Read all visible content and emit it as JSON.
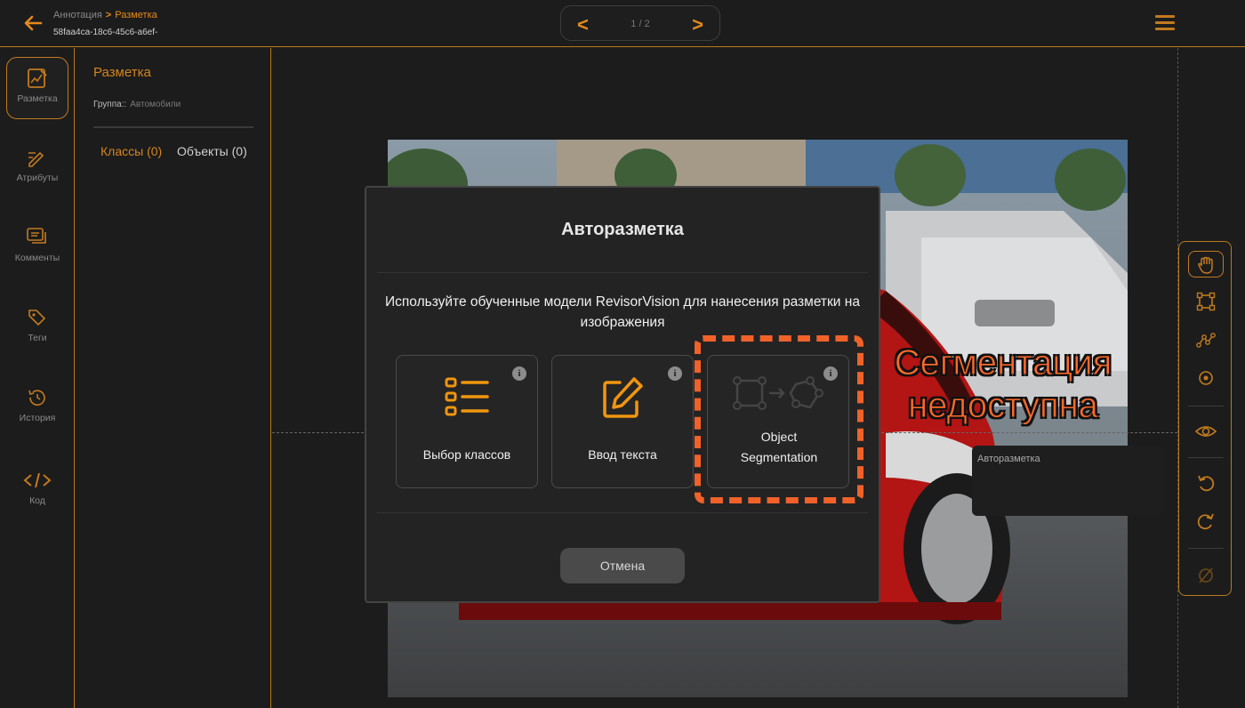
{
  "header": {
    "breadcrumb_parent": "Аннотация",
    "breadcrumb_sep": ">",
    "breadcrumb_current": "Разметка",
    "doc_id": "58faa4ca-18c6-45c6-a6ef-",
    "pager_prev": "<",
    "pager_next": ">",
    "pager_count": "1 / 2"
  },
  "nav": {
    "items": [
      {
        "label": "Разметка",
        "icon": "edit-chart-icon",
        "active": true
      },
      {
        "label": "Атрибуты",
        "icon": "pen-lines-icon"
      },
      {
        "label": "Комменты",
        "icon": "comments-icon"
      },
      {
        "label": "Теги",
        "icon": "tag-icon"
      },
      {
        "label": "История",
        "icon": "history-icon"
      },
      {
        "label": "Код",
        "icon": "code-icon"
      }
    ]
  },
  "panel": {
    "title": "Разметка",
    "group_label": "Группа::",
    "group_value": "Автомобили",
    "tab_classes": "Классы (0)",
    "tab_objects": "Объекты (0)"
  },
  "modal": {
    "title": "Авторазметка",
    "description": "Используйте обученные модели RevisorVision для нанесения разметки на изображения",
    "cards": [
      {
        "label": "Выбор классов",
        "icon": "list-icon",
        "info": "i"
      },
      {
        "label": "Ввод текста",
        "icon": "edit-icon",
        "info": "i"
      },
      {
        "label": "Object Segmentation",
        "icon": "segmentation-icon",
        "info": "i",
        "disabled": true
      }
    ],
    "cancel_label": "Отмена"
  },
  "annotation": {
    "line1": "Сегментация",
    "line2": "недоступна"
  },
  "tooltip": {
    "text": "Авторазметка"
  },
  "toolbar": {
    "tools": [
      "hand-icon",
      "bbox-icon",
      "polyline-icon",
      "point-icon",
      "eye-icon",
      "undo-icon",
      "redo-icon",
      "none-icon"
    ]
  },
  "colors": {
    "accent": "#e58a1c",
    "annotation": "#ff6a2b",
    "background": "#1c1c1c"
  }
}
